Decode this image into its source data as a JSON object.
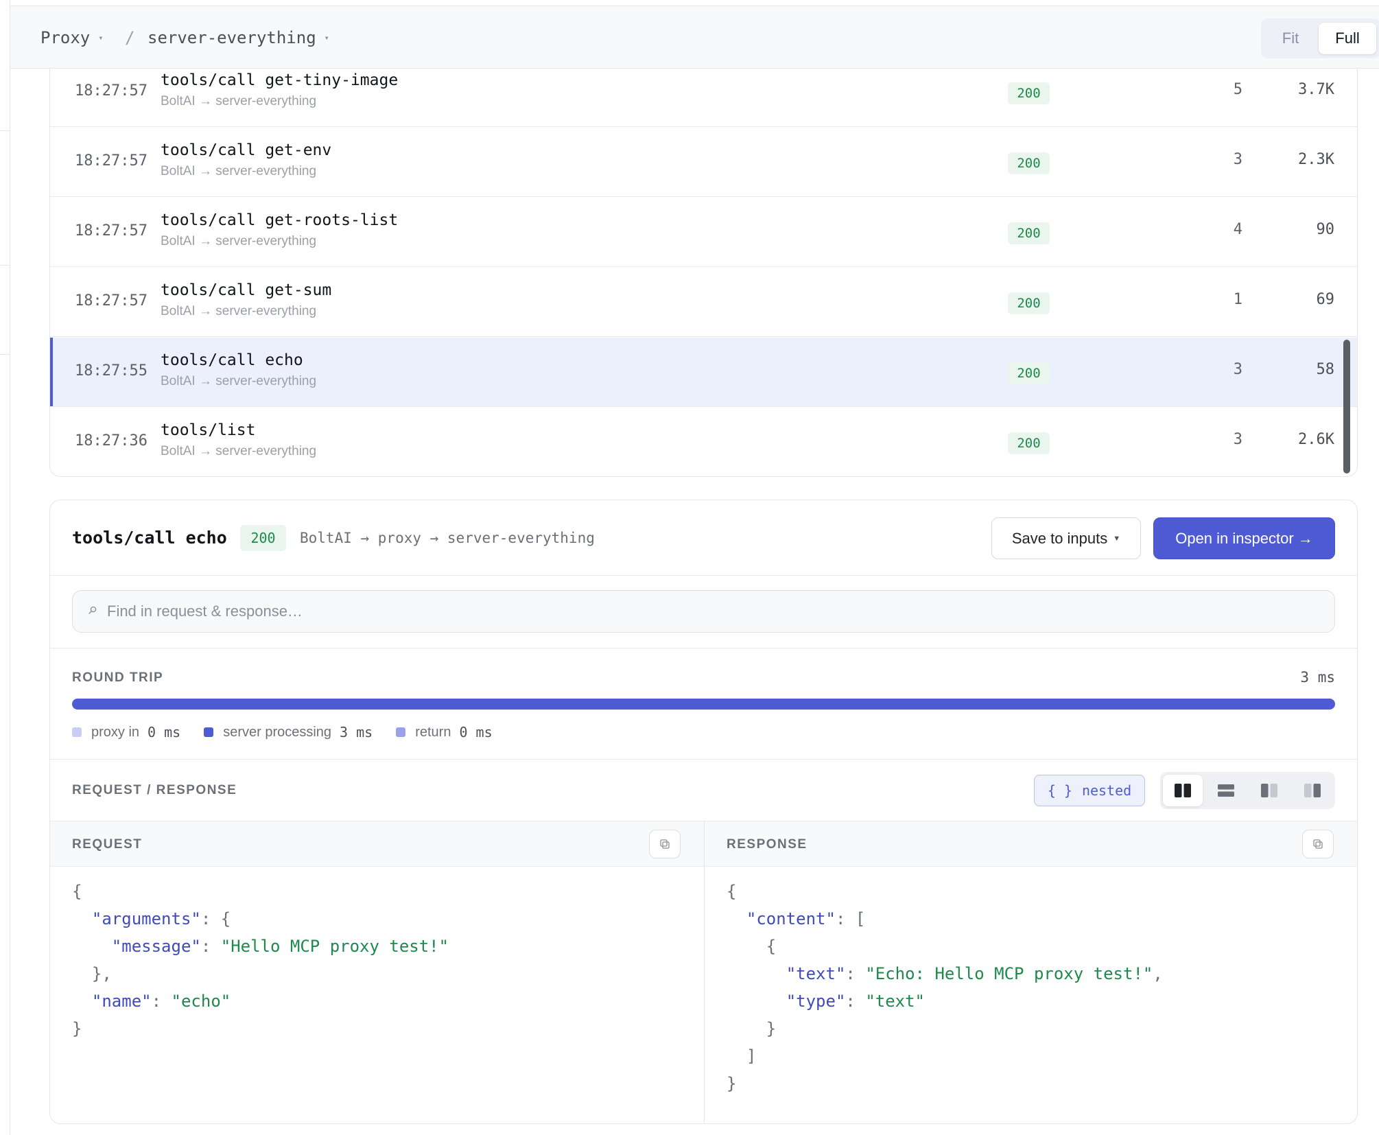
{
  "header": {
    "crumb_root": "Proxy",
    "crumb_separator": "/",
    "crumb_server": "server-everything",
    "view_fit": "Fit",
    "view_full": "Full"
  },
  "requests": [
    {
      "time": "18:27:57",
      "method": "tools/call get-tiny-image",
      "client": "BoltAI",
      "arrow": "→",
      "server": "server-everything",
      "status": "200",
      "count": "5",
      "size": "3.7K"
    },
    {
      "time": "18:27:57",
      "method": "tools/call get-env",
      "client": "BoltAI",
      "arrow": "→",
      "server": "server-everything",
      "status": "200",
      "count": "3",
      "size": "2.3K"
    },
    {
      "time": "18:27:57",
      "method": "tools/call get-roots-list",
      "client": "BoltAI",
      "arrow": "→",
      "server": "server-everything",
      "status": "200",
      "count": "4",
      "size": "90"
    },
    {
      "time": "18:27:57",
      "method": "tools/call get-sum",
      "client": "BoltAI",
      "arrow": "→",
      "server": "server-everything",
      "status": "200",
      "count": "1",
      "size": "69"
    },
    {
      "time": "18:27:55",
      "method": "tools/call echo",
      "client": "BoltAI",
      "arrow": "→",
      "server": "server-everything",
      "status": "200",
      "count": "3",
      "size": "58"
    },
    {
      "time": "18:27:36",
      "method": "tools/list",
      "client": "BoltAI",
      "arrow": "→",
      "server": "server-everything",
      "status": "200",
      "count": "3",
      "size": "2.6K"
    }
  ],
  "selected_index": 4,
  "detail": {
    "title": "tools/call echo",
    "status": "200",
    "path": "BoltAI → proxy → server-everything",
    "save_label": "Save to inputs",
    "open_label": "Open in inspector →",
    "search_placeholder": "Find in request & response…",
    "round_trip": {
      "label": "ROUND TRIP",
      "total": "3 ms",
      "legend": [
        {
          "name": "proxy in",
          "value": "0 ms",
          "color": "#c9ccf3"
        },
        {
          "name": "server processing",
          "value": "3 ms",
          "color": "#4f5bd5"
        },
        {
          "name": "return",
          "value": "0 ms",
          "color": "#9aa1e8"
        }
      ]
    },
    "reqres_label": "REQUEST / RESPONSE",
    "nested_braces": "{ }",
    "nested_label": "nested",
    "request_label": "REQUEST",
    "response_label": "RESPONSE",
    "request_code": {
      "open": "{",
      "k_arguments": "\"arguments\"",
      "open2": "{",
      "k_message": "\"message\"",
      "v_message": "\"Hello MCP proxy test!\"",
      "close2": "},",
      "k_name": "\"name\"",
      "v_name": "\"echo\"",
      "close": "}"
    },
    "response_code": {
      "open": "{",
      "k_content": "\"content\"",
      "open_arr": "[",
      "open_obj": "{",
      "k_text": "\"text\"",
      "v_text": "\"Echo: Hello MCP proxy test!\"",
      "k_type": "\"type\"",
      "v_type": "\"text\"",
      "close_obj": "}",
      "close_arr": "]",
      "close": "}"
    }
  },
  "colors": {
    "accent": "#4f5bd5",
    "status_green": "#1d8a4c",
    "selected_row": "#eceffc"
  }
}
